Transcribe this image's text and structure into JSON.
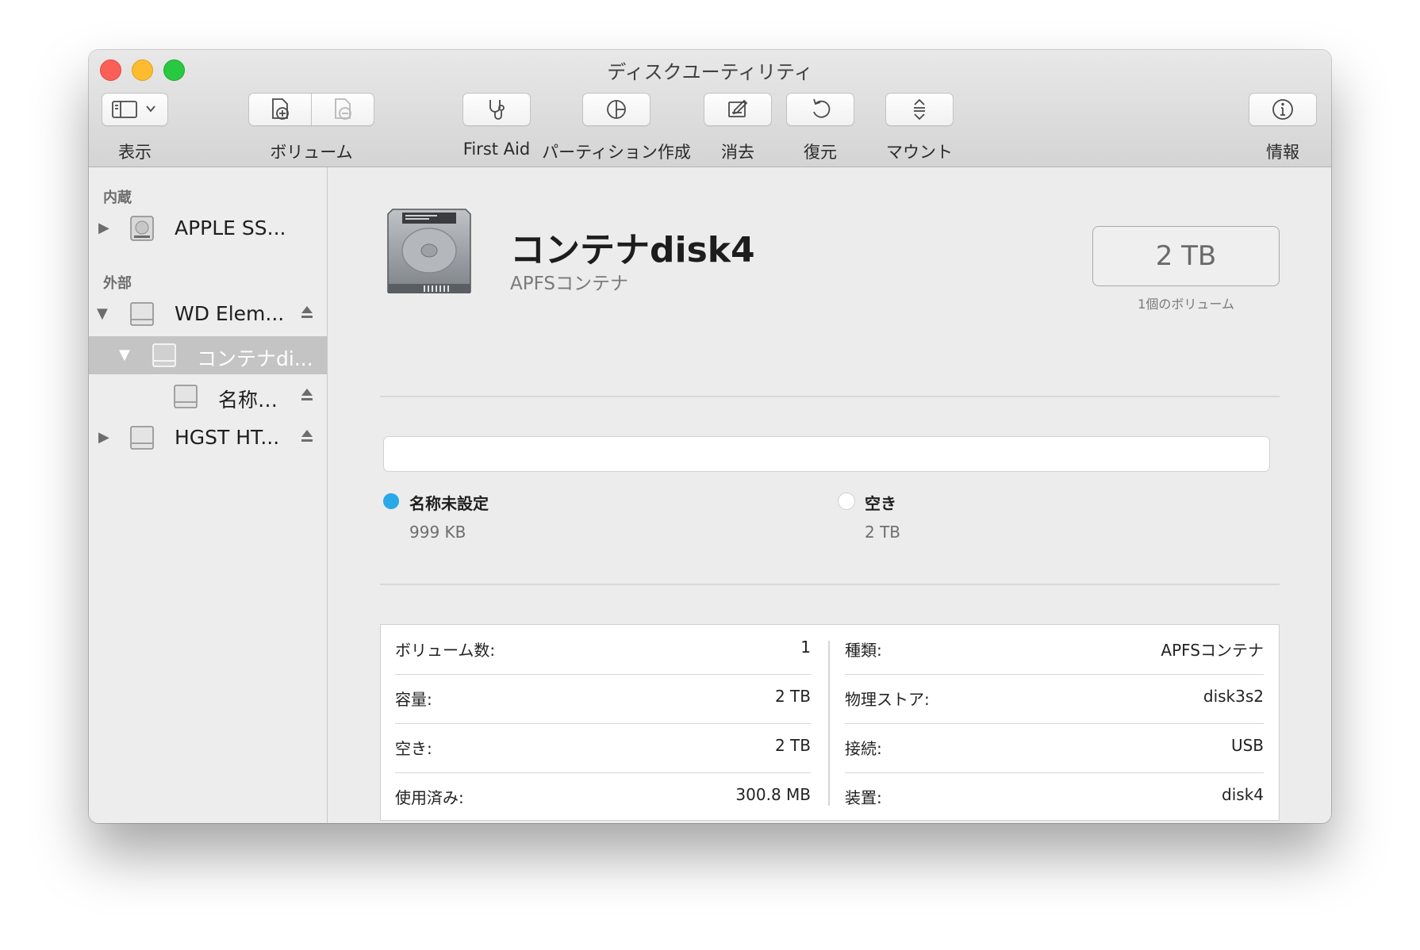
{
  "window": {
    "title": "ディスクユーティリティ"
  },
  "toolbar": {
    "view_label": "表示",
    "volume_label": "ボリューム",
    "first_aid_label": "First Aid",
    "partition_label": "パーティション作成",
    "erase_label": "消去",
    "restore_label": "復元",
    "mount_label": "マウント",
    "info_label": "情報"
  },
  "sidebar": {
    "internal_header": "内蔵",
    "external_header": "外部",
    "items": [
      {
        "name": "APPLE SS..."
      },
      {
        "name": "WD Elem..."
      },
      {
        "name": "コンテナdi..."
      },
      {
        "name": "名称…"
      },
      {
        "name": "HGST HT..."
      }
    ]
  },
  "detail": {
    "title": "コンテナdisk4",
    "subtitle": "APFSコンテナ",
    "size": "2 TB",
    "size_caption": "1個のボリューム",
    "usage": [
      {
        "name": "名称未設定",
        "value": "999 KB",
        "color": "#2aa8e8",
        "fraction": 0.0
      },
      {
        "name": "空き",
        "value": "2 TB",
        "color": "#ffffff",
        "fraction": 1.0
      }
    ],
    "info_left": [
      {
        "label": "ボリューム数:",
        "value": "1"
      },
      {
        "label": "容量:",
        "value": "2 TB"
      },
      {
        "label": "空き:",
        "value": "2 TB"
      },
      {
        "label": "使用済み:",
        "value": "300.8 MB"
      }
    ],
    "info_right": [
      {
        "label": "種類:",
        "value": "APFSコンテナ"
      },
      {
        "label": "物理ストア:",
        "value": "disk3s2"
      },
      {
        "label": "接続:",
        "value": "USB"
      },
      {
        "label": "装置:",
        "value": "disk4"
      }
    ]
  }
}
